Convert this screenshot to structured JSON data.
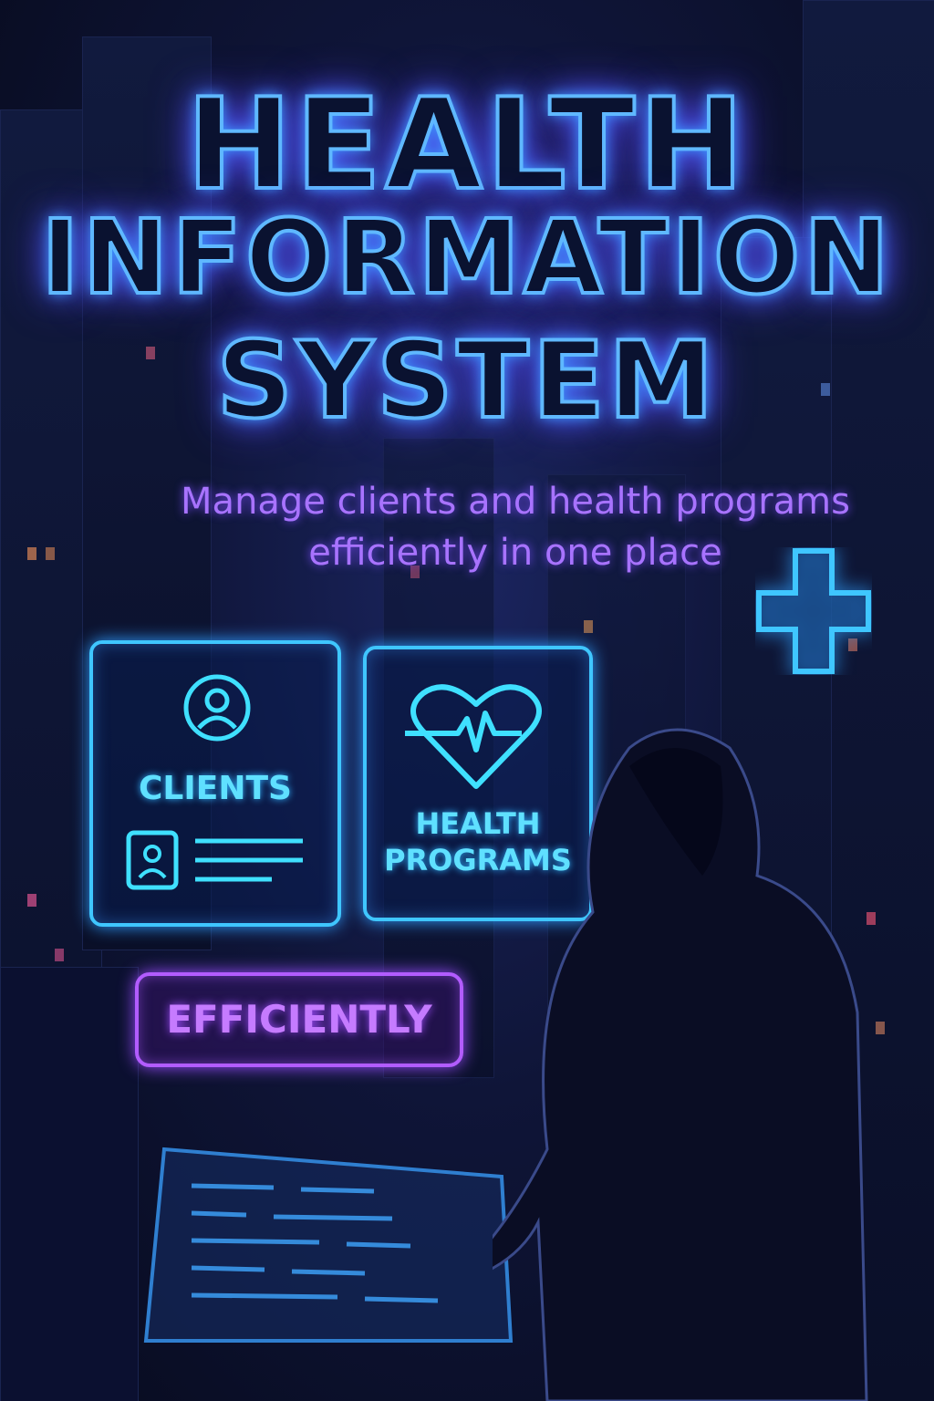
{
  "title": {
    "line1": "HEALTH",
    "line2": "INFORMATION",
    "line3": "SYSTEM"
  },
  "subtitle": {
    "line1": "Manage clients and health programs",
    "line2": "efficiently in one place"
  },
  "panels": {
    "clients": {
      "label": "CLIENTS",
      "icon": "user-circle-icon"
    },
    "programs": {
      "label_line1": "HEALTH",
      "label_line2": "PROGRAMS",
      "icon": "heartbeat-icon"
    }
  },
  "efficiently_label": "EFFICIENTLY",
  "colors": {
    "neon_blue": "#3fc6ff",
    "neon_purple": "#b25cff",
    "background": "#0f1538"
  }
}
